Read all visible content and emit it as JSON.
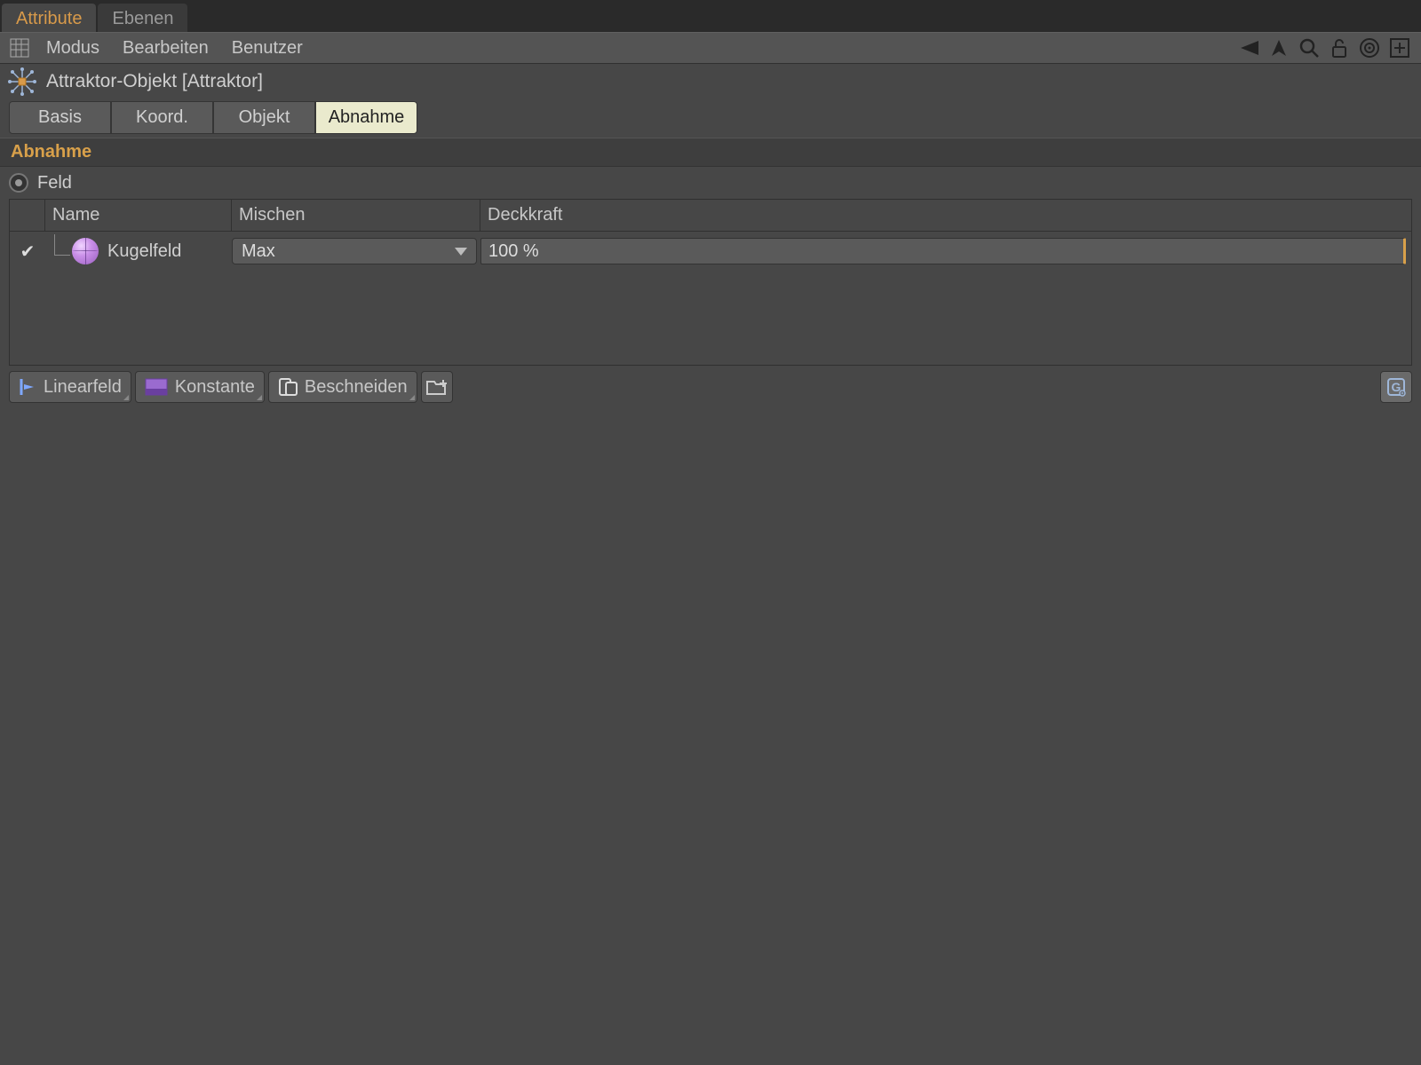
{
  "panel_tabs": {
    "attribute": "Attribute",
    "layers": "Ebenen"
  },
  "menus": {
    "mode": "Modus",
    "edit": "Bearbeiten",
    "user": "Benutzer"
  },
  "object": {
    "title": "Attraktor-Objekt [Attraktor]"
  },
  "subtabs": {
    "basis": "Basis",
    "koord": "Koord.",
    "objekt": "Objekt",
    "abnahme": "Abnahme"
  },
  "section": {
    "abnahme": "Abnahme",
    "feld": "Feld"
  },
  "table": {
    "headers": {
      "name": "Name",
      "mischen": "Mischen",
      "deckkraft": "Deckkraft"
    },
    "row0": {
      "name": "Kugelfeld",
      "mix": "Max",
      "opacity": "100 %"
    }
  },
  "buttons": {
    "linearfeld": "Linearfeld",
    "konstante": "Konstante",
    "beschneiden": "Beschneiden"
  }
}
